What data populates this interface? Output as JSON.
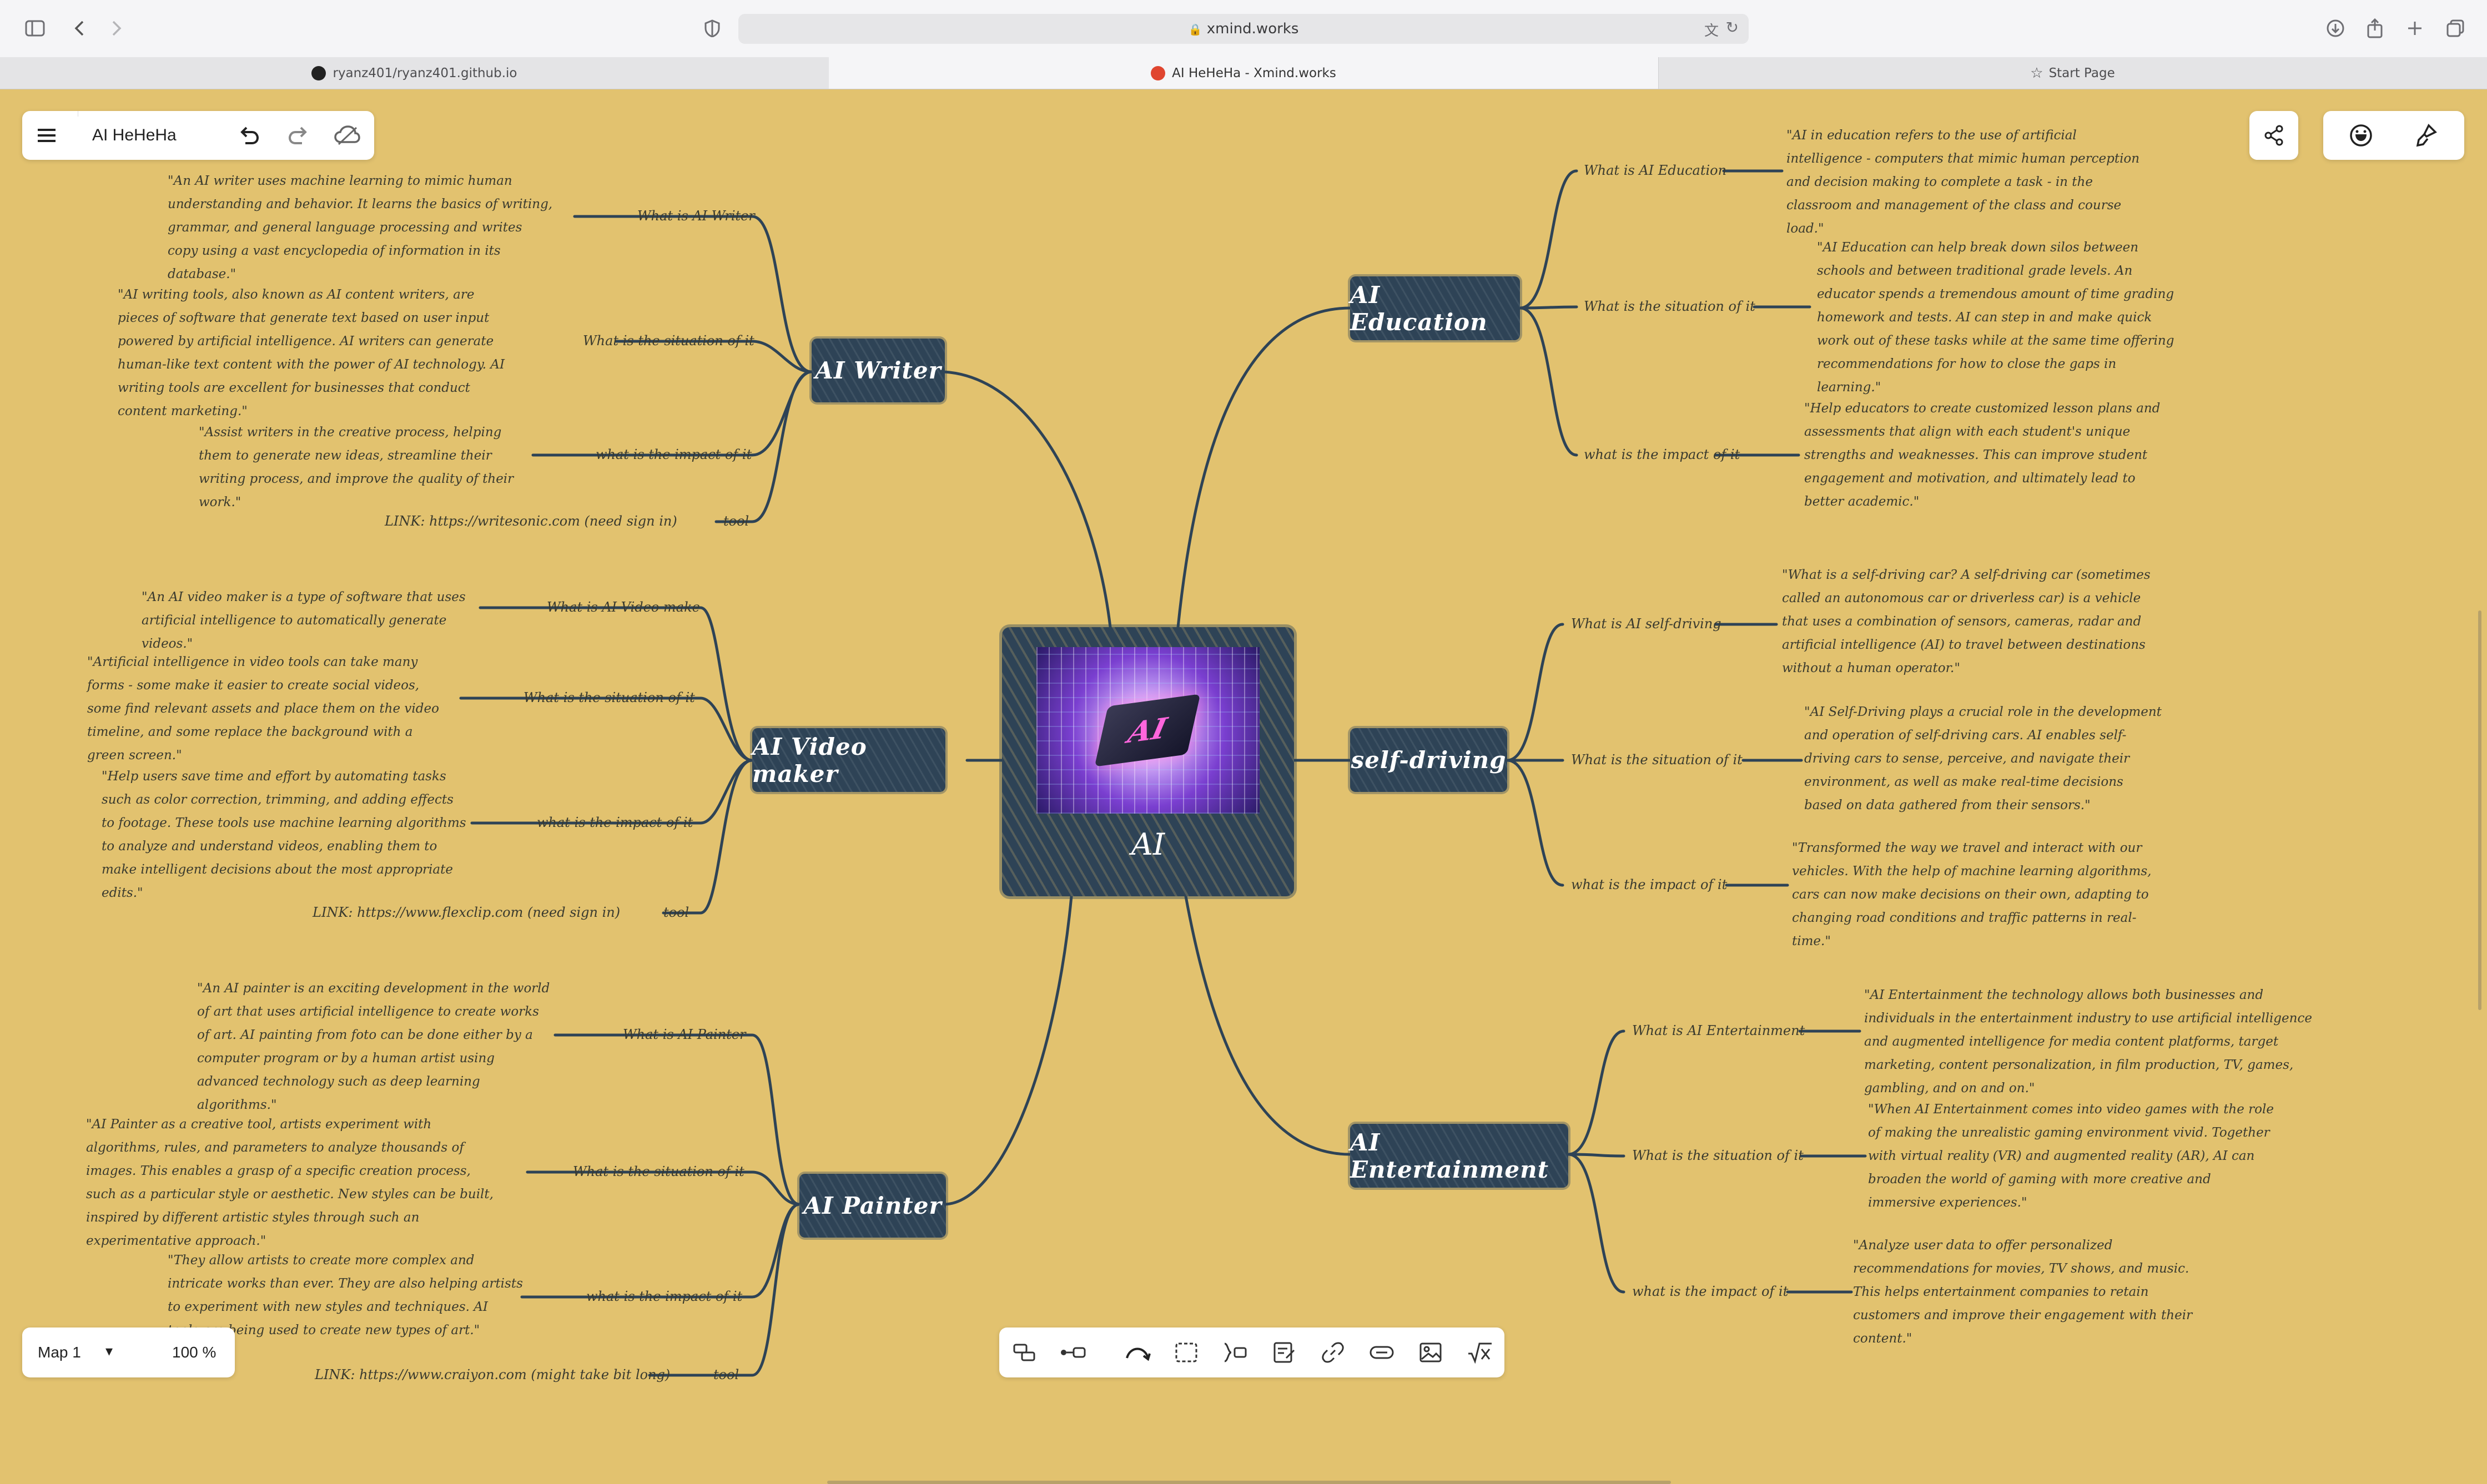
{
  "browser": {
    "url": "xmind.works",
    "tabs": [
      {
        "label": "ryanz401/ryanz401.github.io",
        "active": false
      },
      {
        "label": "AI HeHeHa - Xmind.works",
        "active": true
      },
      {
        "label": "Start Page",
        "active": false
      }
    ]
  },
  "app": {
    "doc_title": "AI HeHeHa",
    "map_name": "Map 1",
    "zoom": "100 %"
  },
  "center": {
    "label": "AI",
    "image_text": "AI"
  },
  "branches": {
    "writer": {
      "label": "AI Writer",
      "topics": [
        {
          "label": "What is AI Writer",
          "text": "\"An AI writer uses machine learning to mimic human understanding and behavior. It learns the basics of writing, grammar, and general language processing and writes copy using a vast encyclopedia of information in its database.\""
        },
        {
          "label": "What is the situation of it",
          "text": "\"AI writing tools, also known as AI content writers, are pieces of software that generate text based on user input powered by artificial intelligence. AI writers can generate human-like text content with the power of AI technology. AI writing tools are excellent for businesses that conduct content marketing.\""
        },
        {
          "label": "what is the impact of it",
          "text": "\"Assist writers in the creative process, helping them to generate new ideas, streamline their writing process, and improve the quality of their work.\""
        },
        {
          "label": "tool",
          "text": "LINK: https://writesonic.com (need sign in)"
        }
      ]
    },
    "video": {
      "label": "AI Video maker",
      "topics": [
        {
          "label": "What is AI Video make",
          "text": "\"An AI video maker is a type of software that uses artificial intelligence to automatically generate videos.\""
        },
        {
          "label": "What is the situation of it",
          "text": "\"Artificial intelligence in video tools can take many forms - some make it easier to create social videos, some find relevant assets and place them on the video timeline, and some replace the background with a green screen.\""
        },
        {
          "label": "what is the impact of it",
          "text": "\"Help users save time and effort by automating tasks such as color correction, trimming, and adding effects to footage. These tools use machine learning algorithms to analyze and understand videos, enabling them to make intelligent decisions about the most appropriate edits.\""
        },
        {
          "label": "tool",
          "text": "LINK: https://www.flexclip.com (need sign in)"
        }
      ]
    },
    "painter": {
      "label": "AI Painter",
      "topics": [
        {
          "label": "What is AI Painter",
          "text": "\"An AI painter is an exciting development in the world of art that uses artificial intelligence to create works of art. AI painting from foto can be done either by a computer program or by a human artist using advanced technology such as deep learning algorithms.\""
        },
        {
          "label": "What is the situation of it",
          "text": "\"AI Painter as a creative tool, artists experiment with algorithms, rules, and parameters to analyze thousands of images. This enables a grasp of a specific creation process, such as a particular style or aesthetic. New styles can be built, inspired by different artistic styles through such an experimentative approach.\""
        },
        {
          "label": "what is the impact of it",
          "text": "\"They allow artists to create more complex and intricate works than ever. They are also helping artists to experiment with new styles and techniques. AI tools are being used to create new types of art.\""
        },
        {
          "label": "tool",
          "text": "LINK: https://www.craiyon.com (might take bit long)"
        }
      ]
    },
    "education": {
      "label": "AI Education",
      "topics": [
        {
          "label": "What is AI Education",
          "text": "\"AI in education refers to the use of artificial intelligence - computers that mimic human perception and decision making to complete a task - in the classroom and management of the class and course load.\""
        },
        {
          "label": "What is the situation of it",
          "text": "\"AI Education can help break down silos between schools and between traditional grade levels. An educator spends a tremendous amount of time grading homework and tests. AI can step in and make quick work out of these tasks while at the same time offering recommendations for how to close the gaps in learning.\""
        },
        {
          "label": "what is the impact of it",
          "text": "\"Help educators to create customized lesson plans and assessments that align with each student's unique strengths and weaknesses. This can improve student engagement and motivation, and ultimately lead to better academic.\""
        }
      ]
    },
    "selfdriving": {
      "label": "self-driving",
      "topics": [
        {
          "label": "What is AI self-driving",
          "text": "\"What is a self-driving car? A self-driving car (sometimes called an autonomous car or driverless car) is a vehicle that uses a combination of sensors, cameras, radar and artificial intelligence (AI) to travel between destinations without a human operator.\""
        },
        {
          "label": "What is the situation of it",
          "text": "\"AI Self-Driving plays a crucial role in the development and operation of self-driving cars. AI enables self-driving cars to sense, perceive, and navigate their environment, as well as make real-time decisions based on data gathered from their sensors.\""
        },
        {
          "label": "what is the impact of it",
          "text": "\"Transformed the way we travel and interact with our vehicles. With the help of machine learning algorithms, cars can now make decisions on their own, adapting to changing road conditions and traffic patterns in real-time.\""
        }
      ]
    },
    "entertainment": {
      "label": "AI Entertainment",
      "topics": [
        {
          "label": "What is AI Entertainment",
          "text": "\"AI Entertainment the technology allows both businesses and individuals in the entertainment industry to use artificial intelligence and augmented intelligence for media content platforms, target marketing, content personalization, in film production, TV, games, gambling, and on and on.\""
        },
        {
          "label": "What is the situation of it",
          "text": "\"When AI Entertainment comes into video games with the role of making the unrealistic gaming environment vivid. Together with virtual reality (VR) and augmented reality (AR), AI can broaden the world of gaming with more creative and immersive experiences.\""
        },
        {
          "label": "what is the impact of it",
          "text": "\"Analyze user data to offer personalized recommendations for movies, TV shows, and music. This helps entertainment companies to retain customers and improve their engagement with their content.\""
        }
      ]
    }
  },
  "icons": {
    "sidebar": "sidebar-icon",
    "back": "chevron-left-icon",
    "forward": "chevron-right-icon",
    "shield": "shield-icon",
    "lock": "lock-icon",
    "translate": "translate-icon",
    "reload": "reload-icon",
    "download": "download-icon",
    "share": "share-icon",
    "newtab": "plus-icon",
    "tabs": "tabs-overview-icon",
    "menu": "menu-icon",
    "undo": "undo-icon",
    "redo": "redo-icon",
    "cloud": "cloud-icon",
    "mapshare": "share-nodes-icon",
    "emoji": "smiley-icon",
    "format": "brush-icon"
  },
  "colors": {
    "canvas": "#e2c26f",
    "node": "#2e4356",
    "line": "#2e4356"
  }
}
